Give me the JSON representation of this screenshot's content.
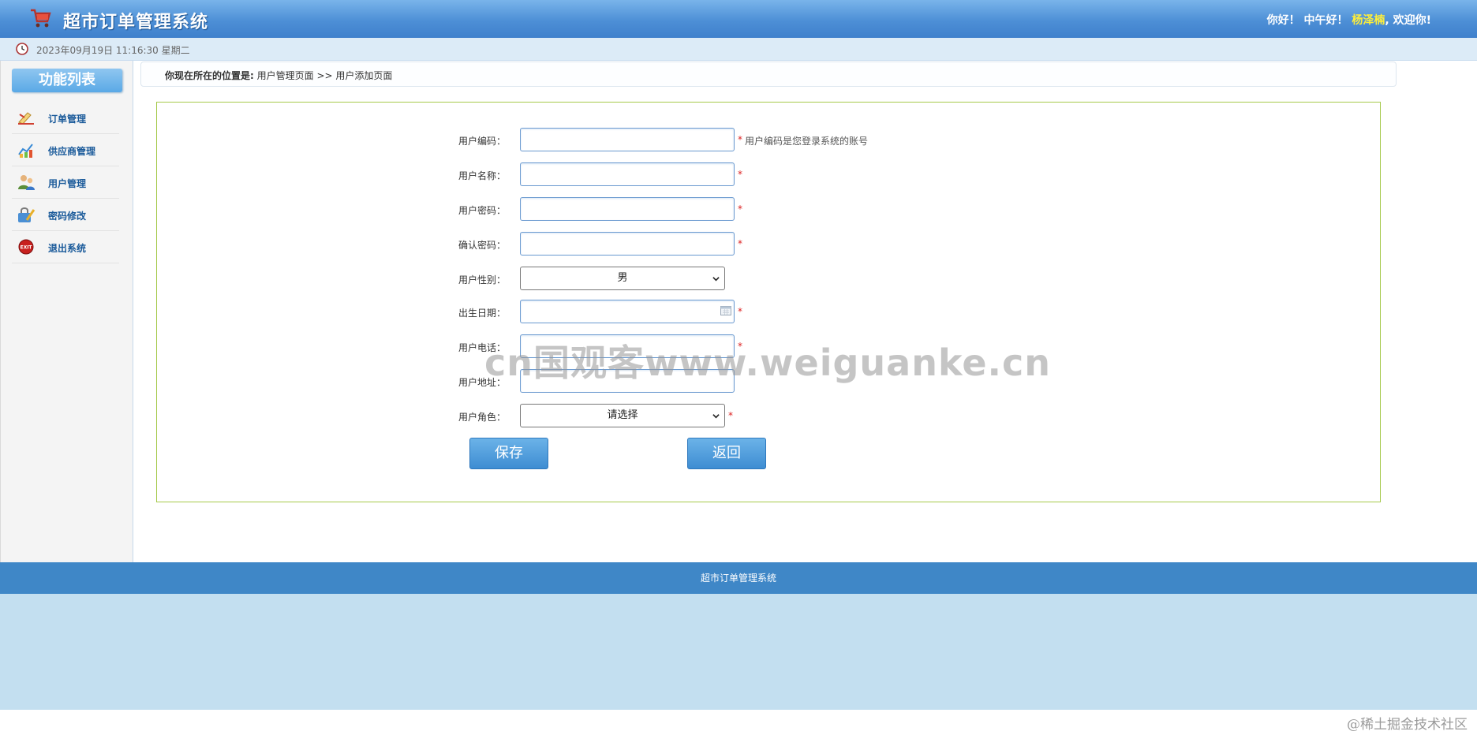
{
  "header": {
    "app_title": "超市订单管理系统",
    "greeting_prefix": "你好！ 中午好！",
    "user_name": "杨泽楠",
    "greeting_suffix": ", 欢迎你!"
  },
  "time_bar": {
    "datetime": "2023年09月19日 11:16:30 星期二"
  },
  "sidebar": {
    "title": "功能列表",
    "items": [
      {
        "label": "订单管理",
        "icon": "order-icon"
      },
      {
        "label": "供应商管理",
        "icon": "supplier-icon"
      },
      {
        "label": "用户管理",
        "icon": "users-icon"
      },
      {
        "label": "密码修改",
        "icon": "password-icon"
      },
      {
        "label": "退出系统",
        "icon": "exit-icon"
      }
    ]
  },
  "breadcrumb": {
    "label": "你现在所在的位置是:",
    "path": "用户管理页面 >> 用户添加页面"
  },
  "form": {
    "fields": [
      {
        "label": "用户编码：",
        "value": "",
        "required": "*",
        "hint": "用户编码是您登录系统的账号"
      },
      {
        "label": "用户名称：",
        "value": "",
        "required": "*"
      },
      {
        "label": "用户密码：",
        "value": "",
        "required": "*"
      },
      {
        "label": "确认密码：",
        "value": "",
        "required": "*"
      },
      {
        "label": "用户性别：",
        "selected": "男"
      },
      {
        "label": "出生日期：",
        "value": "",
        "required": "*"
      },
      {
        "label": "用户电话：",
        "value": "",
        "required": "*"
      },
      {
        "label": "用户地址：",
        "value": ""
      },
      {
        "label": "用户角色：",
        "selected": "请选择",
        "required": "*"
      }
    ],
    "save_label": "保存",
    "back_label": "返回"
  },
  "footer": {
    "text": "超市订单管理系统"
  },
  "overlays": {
    "watermark": "cn国观客www.weiguanke.cn",
    "corner_mark": "@稀土掘金技术社区"
  },
  "colors": {
    "header_blue": "#4d8fd6",
    "footer_blue": "#3f87c7",
    "panel_border": "#a5c94a",
    "required_red": "#d22222",
    "username_yellow": "#ffef3a"
  }
}
